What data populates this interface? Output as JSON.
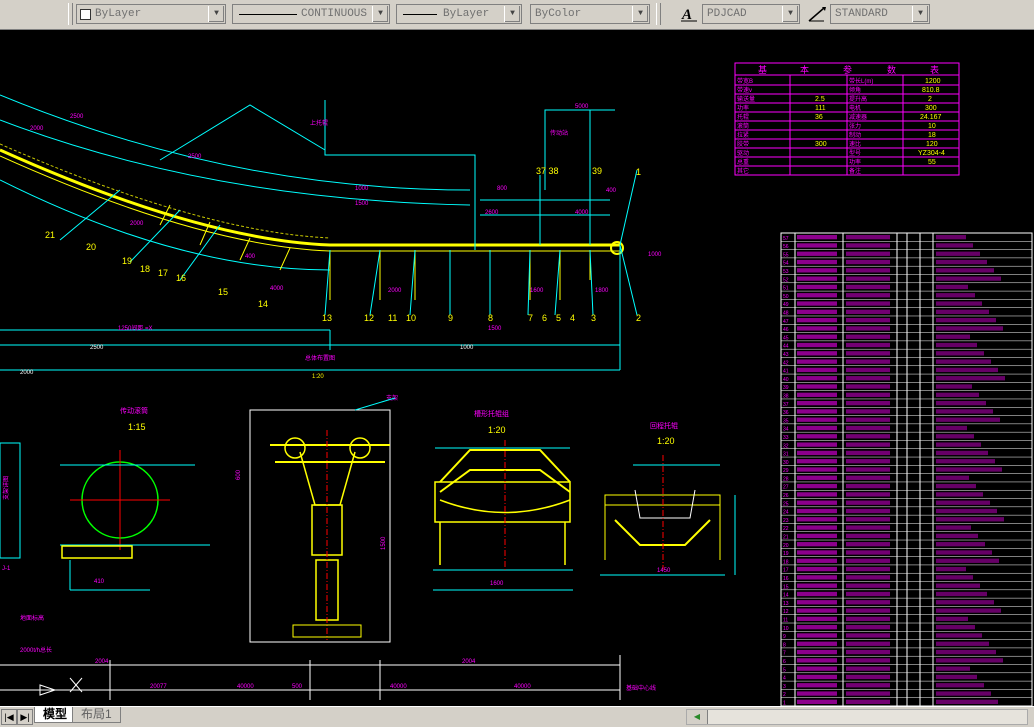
{
  "toolbar": {
    "layer_combo": "ByLayer",
    "linetype_combo": "CONTINUOUS",
    "lineweight_combo": "ByLayer",
    "color_combo": "ByColor",
    "text_style_combo": "PDJCAD",
    "dim_style_combo": "STANDARD"
  },
  "drawing": {
    "section_top_title": "1:20",
    "view_left_scale": "1:15",
    "view_mid_scale": "1:20",
    "view_right_scale": "1:20",
    "param_table_header": [
      "基",
      "本",
      "参",
      "数",
      "表"
    ],
    "param_rows": [
      [
        "",
        "",
        "",
        "1200"
      ],
      [
        "",
        "",
        "",
        "810.8"
      ],
      [
        "",
        "2.5",
        "",
        "2"
      ],
      [
        "",
        "111",
        "",
        "300"
      ],
      [
        "",
        "36",
        "",
        "24.167"
      ],
      [
        "",
        "",
        "",
        "10"
      ],
      [
        "",
        "",
        "",
        "18"
      ],
      [
        "",
        "300",
        "",
        "120"
      ],
      [
        "",
        "",
        "",
        "YZ304-4"
      ],
      [
        "",
        "",
        "",
        "55"
      ]
    ],
    "item_numbers": [
      "1",
      "2",
      "3",
      "4",
      "5",
      "6",
      "7",
      "8",
      "9",
      "10",
      "11",
      "12",
      "13",
      "14",
      "15",
      "16",
      "17",
      "18",
      "19",
      "20",
      "21",
      "22",
      "23",
      "24",
      "25",
      "26",
      "27",
      "28",
      "29",
      "30",
      "31",
      "32",
      "33",
      "34",
      "35",
      "36",
      "37",
      "38",
      "39",
      "40",
      "41",
      "42",
      "43",
      "44",
      "45",
      "46",
      "47",
      "48",
      "49",
      "50",
      "51",
      "52",
      "53",
      "54",
      "55",
      "56",
      "57",
      "58",
      "59",
      "60",
      "61",
      "62",
      "63",
      "64",
      "65",
      "66",
      "67",
      "68",
      "69",
      "70",
      "71",
      "72",
      "73",
      "74",
      "75",
      "76",
      "77",
      "78",
      "79",
      "80",
      "81",
      "82",
      "83",
      "84",
      "85",
      "86",
      "87",
      "88",
      "89",
      "90"
    ],
    "callouts_upper": [
      "1",
      "2",
      "3",
      "4",
      "5",
      "6",
      "7",
      "8",
      "9",
      "10",
      "11",
      "12",
      "13",
      "14",
      "15",
      "16",
      "17",
      "18",
      "19",
      "20"
    ],
    "dim_labels": [
      "5000",
      "2000",
      "2500",
      "1000",
      "2004",
      "2004",
      "1090",
      "1600",
      "1450"
    ]
  },
  "status": {
    "tab_model": "模型",
    "tab_layout1": "布局1"
  },
  "colors": {
    "canvas": "#000000",
    "yellow": "#ffff00",
    "cyan": "#00ffff",
    "magenta": "#ff00ff",
    "white": "#ffffff",
    "ui_gray": "#d4d0c8"
  }
}
